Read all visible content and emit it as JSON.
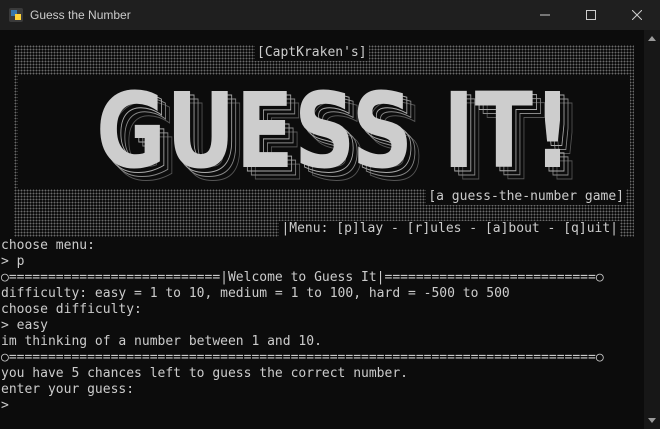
{
  "window": {
    "title": "Guess the Number"
  },
  "banner": {
    "credit": "[CaptKraken's]",
    "big_title": "GUESS IT!",
    "tagline": "[a guess-the-number game]",
    "menu": "|Menu: [p]lay - [r]ules - [a]bout - [q]uit|"
  },
  "console": {
    "lines": [
      "choose menu:",
      "> p",
      "○===========================|Welcome to Guess It|===========================○",
      "difficulty: easy = 1 to 10, medium = 1 to 100, hard = -500 to 500",
      "choose difficulty:",
      "> easy",
      "im thinking of a number between 1 and 10.",
      "○===========================================================================○",
      "you have 5 chances left to guess the correct number.",
      "enter your guess:",
      ">"
    ]
  },
  "colors": {
    "background": "#0c0c0c",
    "text": "#cccccc",
    "titlebar": "#1f1f1f"
  }
}
